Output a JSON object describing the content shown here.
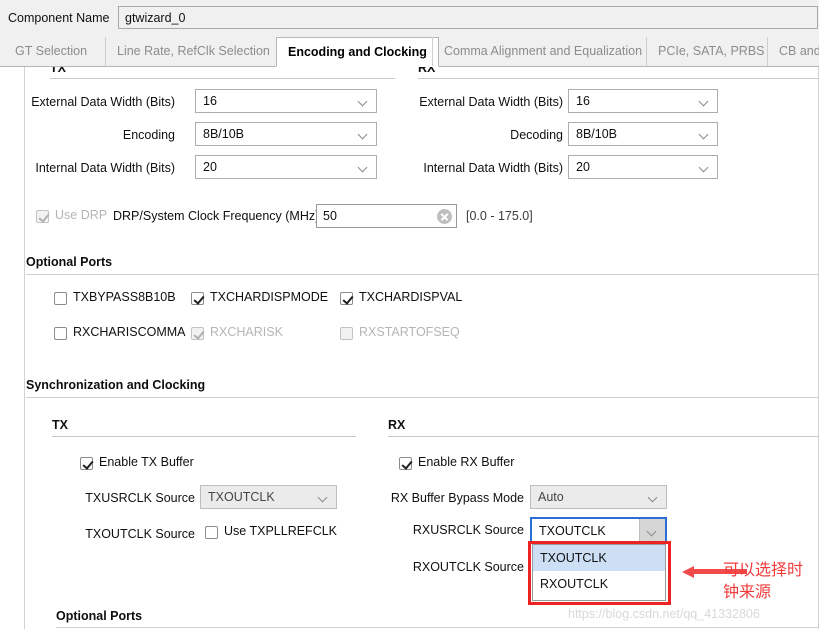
{
  "topbar": {
    "component_name_label": "Component Name",
    "component_name_value": "gtwizard_0"
  },
  "tabs": [
    {
      "label": "GT Selection",
      "active": false
    },
    {
      "label": "Line Rate, RefClk Selection",
      "active": false
    },
    {
      "label": "Encoding and Clocking",
      "active": true
    },
    {
      "label": "Comma Alignment and Equalization",
      "active": false
    },
    {
      "label": "PCIe, SATA, PRBS",
      "active": false
    },
    {
      "label": "CB and",
      "active": false
    }
  ],
  "tx_group": {
    "title": "TX",
    "fields": [
      {
        "label": "External Data Width (Bits)",
        "value": "16"
      },
      {
        "label": "Encoding",
        "value": "8B/10B"
      },
      {
        "label": "Internal Data Width (Bits)",
        "value": "20"
      }
    ]
  },
  "rx_group": {
    "title": "RX",
    "fields": [
      {
        "label": "External Data Width (Bits)",
        "value": "16"
      },
      {
        "label": "Decoding",
        "value": "8B/10B"
      },
      {
        "label": "Internal Data Width (Bits)",
        "value": "20"
      }
    ]
  },
  "drp_row": {
    "use_drp_label": "Use DRP",
    "use_drp_checked": true,
    "frequency_label": "DRP/System Clock Frequency (MHz)",
    "frequency_value": "50",
    "range_hint": "[0.0 - 175.0]"
  },
  "optional_ports_top": {
    "title": "Optional Ports",
    "row1": [
      {
        "label": "TXBYPASS8B10B",
        "checked": false,
        "disabled": false
      },
      {
        "label": "TXCHARDISPMODE",
        "checked": true,
        "disabled": false
      },
      {
        "label": "TXCHARDISPVAL",
        "checked": true,
        "disabled": false
      }
    ],
    "row2": [
      {
        "label": "RXCHARISCOMMA",
        "checked": false,
        "disabled": false
      },
      {
        "label": "RXCHARISK",
        "checked": true,
        "disabled": true
      },
      {
        "label": "RXSTARTOFSEQ",
        "checked": false,
        "disabled": true
      }
    ]
  },
  "sync_section": {
    "title": "Synchronization and Clocking",
    "tx": {
      "title": "TX",
      "enable_buffer_label": "Enable TX Buffer",
      "enable_buffer_checked": true,
      "txusrclk_label": "TXUSRCLK Source",
      "txusrclk_value": "TXOUTCLK",
      "txoutclk_label": "TXOUTCLK Source",
      "use_txpllrefclk_label": "Use TXPLLREFCLK",
      "use_txpllrefclk_checked": false
    },
    "rx": {
      "title": "RX",
      "enable_buffer_label": "Enable RX Buffer",
      "enable_buffer_checked": true,
      "bypass_mode_label": "RX Buffer Bypass Mode",
      "bypass_mode_value": "Auto",
      "rxusrclk_label": "RXUSRCLK Source",
      "rxusrclk_value": "TXOUTCLK",
      "rxoutclk_label": "RXOUTCLK Source",
      "dropdown_options": [
        "TXOUTCLK",
        "RXOUTCLK"
      ],
      "dropdown_selected": "TXOUTCLK"
    }
  },
  "optional_ports_bottom": {
    "title": "Optional Ports"
  },
  "annotation": {
    "text": "可以选择时\n钟来源",
    "color": "#f23b3b"
  },
  "watermark": {
    "text": "https://blog.csdn.net/qq_41332806"
  }
}
